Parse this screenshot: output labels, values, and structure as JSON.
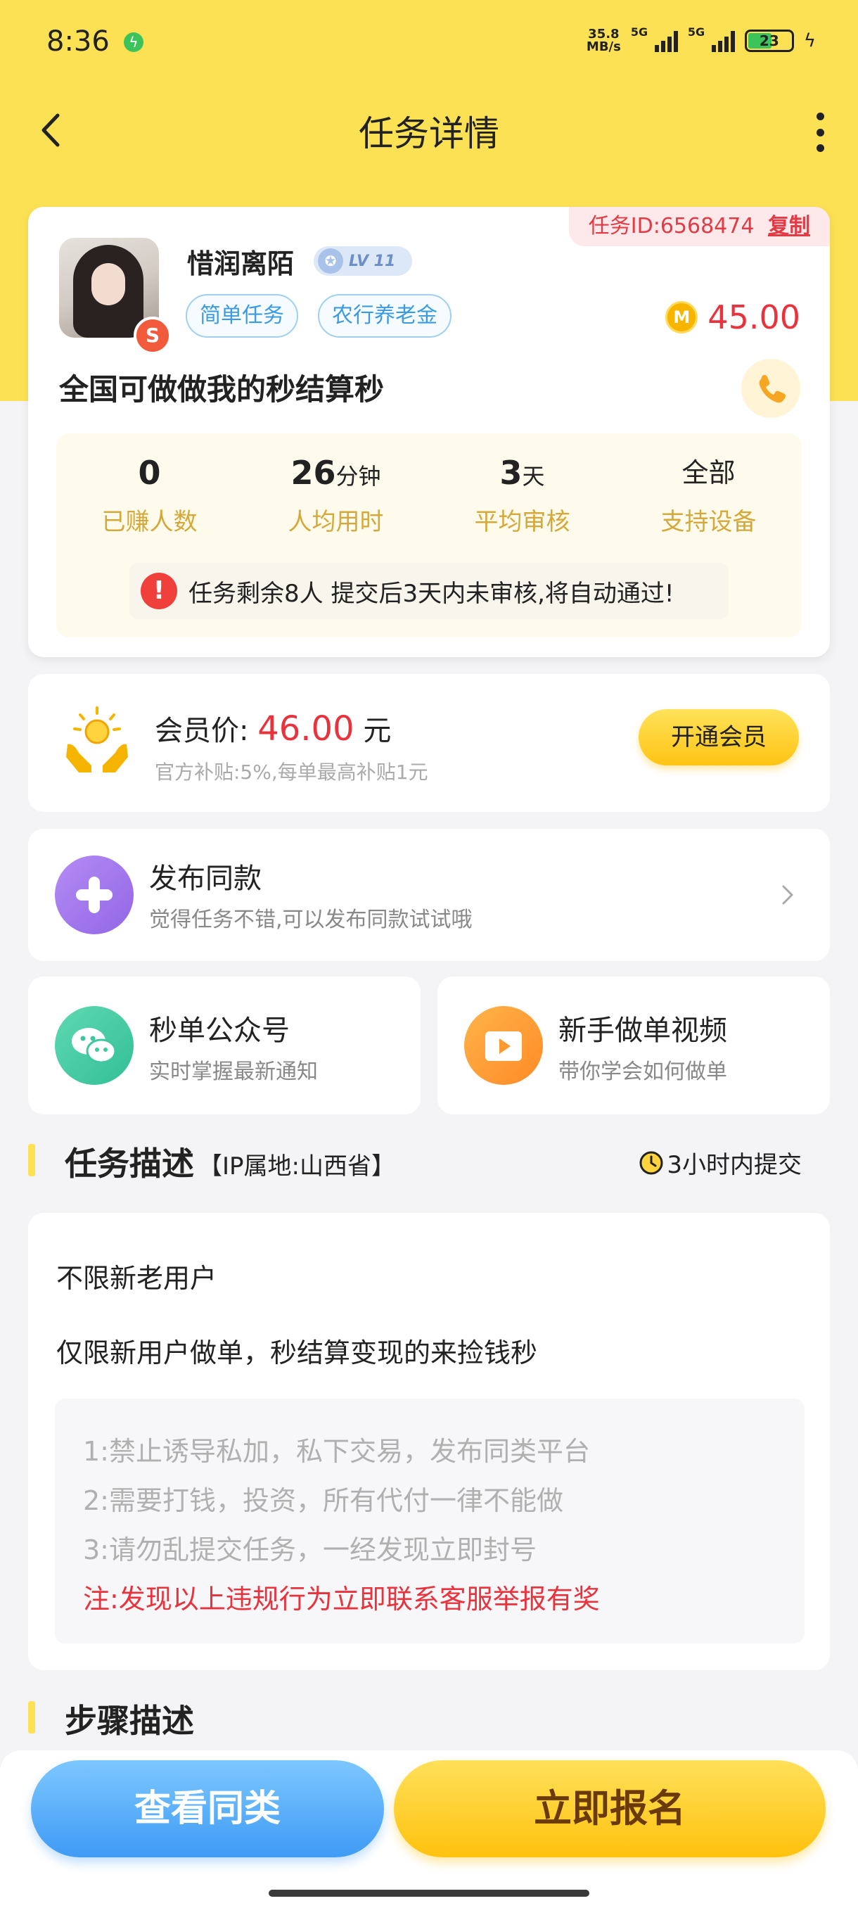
{
  "status_bar": {
    "time": "8:36",
    "net_speed_value": "35.8",
    "net_speed_unit": "MB/s",
    "signal_1": "5G",
    "signal_2": "5G",
    "battery": "23"
  },
  "header": {
    "title": "任务详情"
  },
  "task": {
    "id_label": "任务ID:6568474",
    "copy_label": "复制",
    "user_name": "惜润离陌",
    "level": "LV 11",
    "tags": [
      "简单任务",
      "农行养老金"
    ],
    "price": "45.00",
    "coin_glyph": "M",
    "rank_glyph": "S",
    "title": "全国可做做我的秒结算秒",
    "stats": [
      {
        "value": "0",
        "unit": "",
        "label": "已赚人数"
      },
      {
        "value": "26",
        "unit": "分钟",
        "label": "人均用时"
      },
      {
        "value": "3",
        "unit": "天",
        "label": "平均审核"
      },
      {
        "value": "全部",
        "unit": "",
        "label": "支持设备"
      }
    ],
    "notice": "任务剩余8人  提交后3天内未审核,将自动通过!"
  },
  "member": {
    "label": "会员价:",
    "price": "46.00",
    "unit": "元",
    "subtitle": "官方补贴:5%,每单最高补贴1元",
    "button": "开通会员"
  },
  "publish": {
    "title": "发布同款",
    "subtitle": "觉得任务不错,可以发布同款试试哦"
  },
  "shortcuts": {
    "wechat_title": "秒单公众号",
    "wechat_sub": "实时掌握最新通知",
    "video_title": "新手做单视频",
    "video_sub": "带你学会如何做单"
  },
  "description_section": {
    "title": "任务描述",
    "ip": "【IP属地:山西省】",
    "deadline": "3小时内提交"
  },
  "description": {
    "line1": "不限新老用户",
    "line2": "仅限新用户做单，秒结算变现的来捡钱秒",
    "rules": [
      "1:禁止诱导私加，私下交易，发布同类平台",
      "2:需要打钱，投资，所有代付一律不能做",
      "3:请勿乱提交任务，一经发现立即封号"
    ],
    "warning": "注:发现以上违规行为立即联系客服举报有奖"
  },
  "steps_section": {
    "title": "步骤描述"
  },
  "bottom": {
    "similar_button": "查看同类",
    "signup_button": "立即报名"
  },
  "colors": {
    "brand_yellow": "#fde155",
    "price_red": "#e8333d",
    "tag_blue": "#3a9be0",
    "stat_gold": "#d4a93a"
  }
}
